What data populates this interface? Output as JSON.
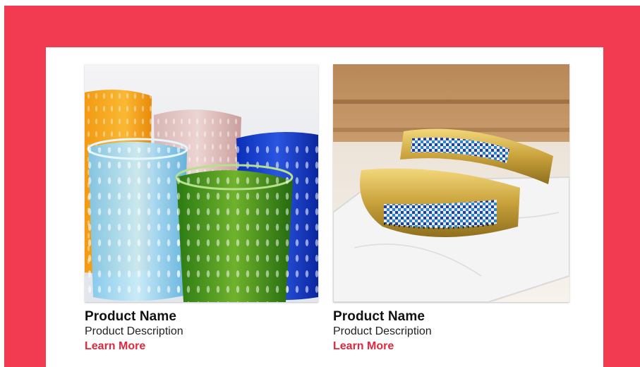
{
  "colors": {
    "frame": "#f23a50",
    "panel": "#ffffff",
    "link": "#e0283e"
  },
  "products": [
    {
      "image_subject": "colorful dotted drinking glasses",
      "name": "Product Name",
      "description": "Product Description",
      "link_label": "Learn More"
    },
    {
      "image_subject": "brass cuff bracelets with beadwork",
      "name": "Product Name",
      "description": "Product Description",
      "link_label": "Learn More"
    }
  ]
}
